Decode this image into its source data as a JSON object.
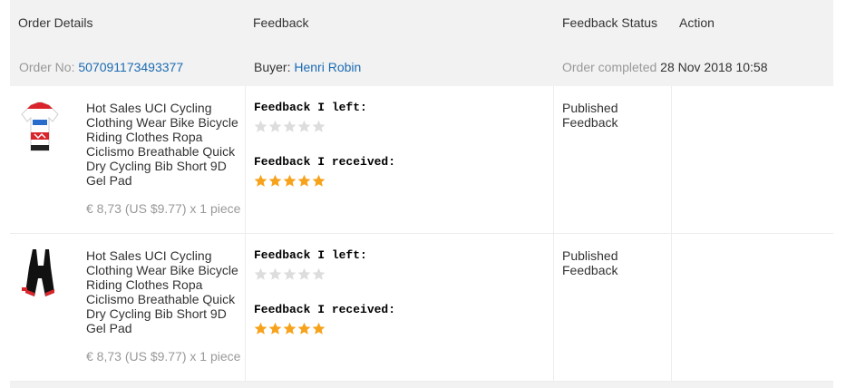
{
  "header": {
    "order_details": "Order Details",
    "feedback": "Feedback",
    "feedback_status": "Feedback Status",
    "action": "Action"
  },
  "order": {
    "order_no_label": "Order No:",
    "order_no": "507091173493377",
    "buyer_label": "Buyer:",
    "buyer": "Henri Robin",
    "status_text": "Order completed",
    "completed_date": "28 Nov 2018 10:58"
  },
  "items": [
    {
      "title": "Hot Sales UCI Cycling Clothing Wear Bike Bicycle Riding Clothes Ropa Ciclismo Breathable Quick Dry Cycling Bib Short 9D Gel Pad",
      "price": "€ 8,73 (US $9.77) x 1 piece",
      "feedback_left_label": "Feedback I left:",
      "feedback_left_stars": 0,
      "feedback_received_label": "Feedback I received:",
      "feedback_received_stars": 5,
      "status": "Published Feedback",
      "image": "cycling-jersey"
    },
    {
      "title": "Hot Sales UCI Cycling Clothing Wear Bike Bicycle Riding Clothes Ropa Ciclismo Breathable Quick Dry Cycling Bib Short 9D Gel Pad",
      "price": "€ 8,73 (US $9.77) x 1 piece",
      "feedback_left_label": "Feedback I left:",
      "feedback_left_stars": 0,
      "feedback_received_label": "Feedback I received:",
      "feedback_received_stars": 5,
      "status": "Published Feedback",
      "image": "bib-shorts"
    }
  ],
  "colors": {
    "star_filled": "#f7a21b",
    "star_empty": "#dddddd",
    "link": "#1b6bb3",
    "header_bg": "#f2f2f2"
  }
}
